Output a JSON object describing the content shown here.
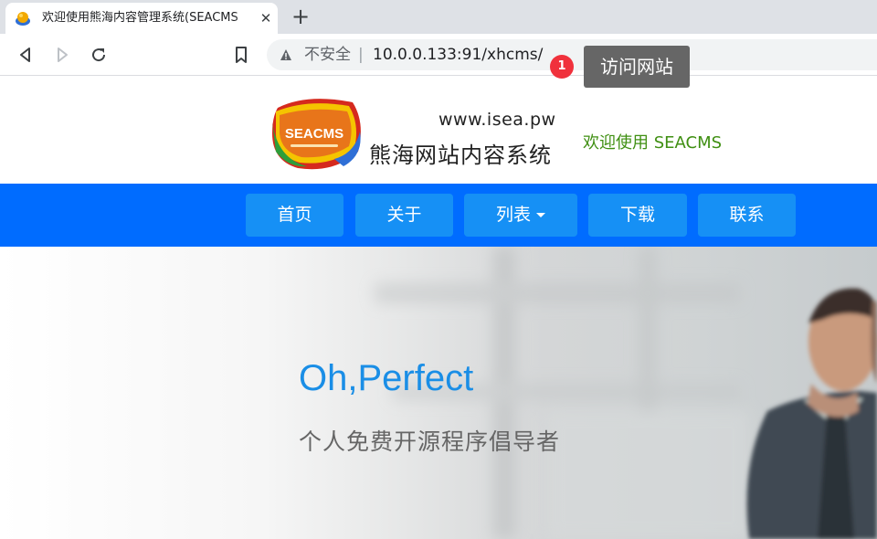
{
  "browser": {
    "tab_title": "欢迎使用熊海内容管理系统(SEACMS",
    "tab_close": "✕",
    "new_tab": "+",
    "security_label": "不安全",
    "separator": "|",
    "url": "10.0.0.133:91/xhcms/"
  },
  "annotation": {
    "step": "1",
    "tooltip": "访问网站"
  },
  "header": {
    "logo_text": "SEACMS",
    "logo_domain": "www.isea.pw",
    "logo_name": "熊海网站内容系统",
    "welcome": "欢迎使用 SEACMS"
  },
  "nav": {
    "items": [
      "首页",
      "关于",
      "列表",
      "下载",
      "联系"
    ]
  },
  "hero": {
    "title": "Oh,Perfect",
    "subtitle": "个人免费开源程序倡导者"
  },
  "colors": {
    "navbar": "#006cff",
    "nav_button": "#1690f5",
    "welcome_green": "#3f8f12",
    "hero_title_blue": "#1a8ee6",
    "badge_red": "#f0313c"
  },
  "icons": [
    "favicon-icon",
    "close-icon",
    "plus-icon",
    "back-icon",
    "forward-icon",
    "reload-icon",
    "bookmark-icon",
    "warning-icon",
    "caret-down-icon"
  ]
}
